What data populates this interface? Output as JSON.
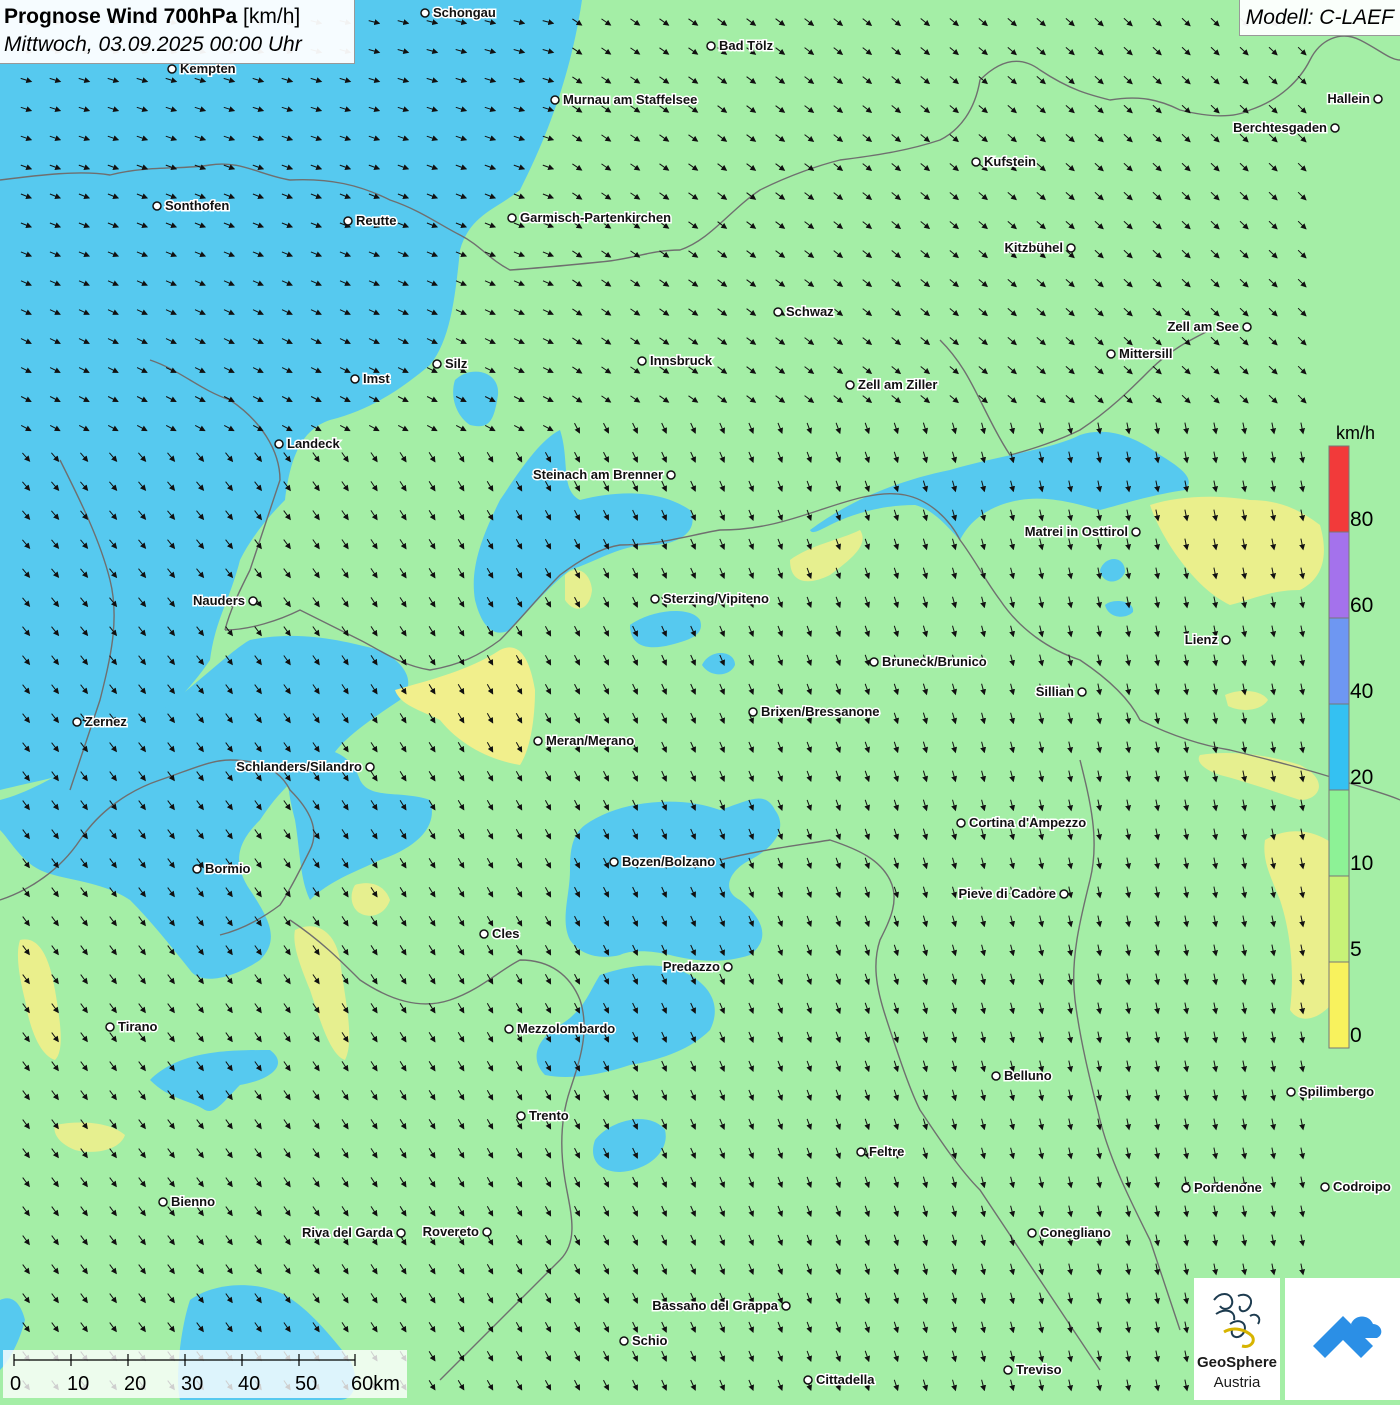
{
  "header": {
    "title_bold": "Prognose Wind 700hPa",
    "title_unit": "[km/h]",
    "datetime": "Mittwoch, 03.09.2025 00:00 Uhr"
  },
  "model_label": "Modell: C-LAEF",
  "legend": {
    "unit": "km/h",
    "labels": [
      "80",
      "60",
      "40",
      "20",
      "10",
      "5",
      "0"
    ],
    "colors": [
      "#f23a3a",
      "#a472ec",
      "#6e97f2",
      "#34c1f2",
      "#8df296",
      "#c8f277",
      "#f8f25d"
    ]
  },
  "colors": {
    "speed_0_5": "#f1ef8c",
    "speed_5_10": "#c9ef8e",
    "speed_10_20": "#a4eea6",
    "speed_20_40": "#56c9ef",
    "borders": "#777777"
  },
  "scale_bar": {
    "ticks": [
      "0",
      "10",
      "20",
      "30",
      "40",
      "50",
      "60km"
    ]
  },
  "cities": [
    {
      "name": "Schongau"
    },
    {
      "name": "Bad Tölz"
    },
    {
      "name": "Kempten"
    },
    {
      "name": "Murnau am Staffelsee"
    },
    {
      "name": "Hallein"
    },
    {
      "name": "Berchtesgaden"
    },
    {
      "name": "Kufstein"
    },
    {
      "name": "Sonthofen"
    },
    {
      "name": "Reutte"
    },
    {
      "name": "Garmisch-Partenkirchen"
    },
    {
      "name": "Kitzbühel"
    },
    {
      "name": "Schwaz"
    },
    {
      "name": "Zell am See"
    },
    {
      "name": "Innsbruck"
    },
    {
      "name": "Mittersill"
    },
    {
      "name": "Silz"
    },
    {
      "name": "Imst"
    },
    {
      "name": "Zell am Ziller"
    },
    {
      "name": "Landeck"
    },
    {
      "name": "Steinach am Brenner"
    },
    {
      "name": "Matrei in Osttirol"
    },
    {
      "name": "Nauders"
    },
    {
      "name": "Sterzing/Vipiteno"
    },
    {
      "name": "Lienz"
    },
    {
      "name": "Bruneck/Brunico"
    },
    {
      "name": "Sillian"
    },
    {
      "name": "Brixen/Bressanone"
    },
    {
      "name": "Zernez"
    },
    {
      "name": "Meran/Merano"
    },
    {
      "name": "Schlanders/Silandro"
    },
    {
      "name": "Cortina d'Ampezzo"
    },
    {
      "name": "Bozen/Bolzano"
    },
    {
      "name": "Bormio"
    },
    {
      "name": "Pieve di Cadore"
    },
    {
      "name": "Cles"
    },
    {
      "name": "Predazzo"
    },
    {
      "name": "Tirano"
    },
    {
      "name": "Mezzolombardo"
    },
    {
      "name": "Belluno"
    },
    {
      "name": "Spilimbergo"
    },
    {
      "name": "Trento"
    },
    {
      "name": "Feltre"
    },
    {
      "name": "Bienno"
    },
    {
      "name": "Pordenone"
    },
    {
      "name": "Codroipo"
    },
    {
      "name": "Riva del Garda"
    },
    {
      "name": "Rovereto"
    },
    {
      "name": "Conegliano"
    },
    {
      "name": "Bassano del Grappa"
    },
    {
      "name": "Schio"
    },
    {
      "name": "Treviso"
    },
    {
      "name": "Cittadella"
    }
  ],
  "logos": {
    "geosphere_line1": "GeoSphere",
    "geosphere_line2": "Austria"
  }
}
